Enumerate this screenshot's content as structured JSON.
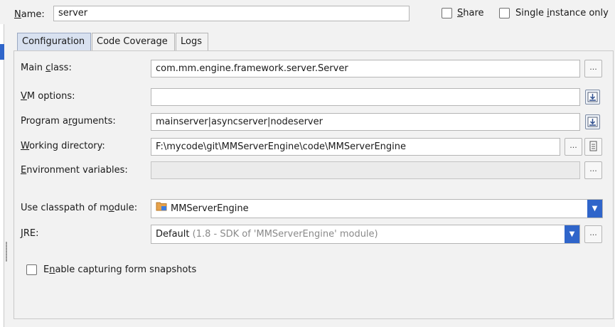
{
  "header": {
    "name_label": "Name:",
    "name_value": "server",
    "share_label": "Share",
    "share_checked": false,
    "single_instance_label": "Single instance only",
    "single_instance_checked": false
  },
  "tabs": [
    {
      "label": "Configuration",
      "active": true
    },
    {
      "label": "Code Coverage",
      "active": false
    },
    {
      "label": "Logs",
      "active": false
    }
  ],
  "form": {
    "main_class": {
      "label": "Main class:",
      "value": "com.mm.engine.framework.server.Server",
      "button": "..."
    },
    "vm_options": {
      "label": "VM options:",
      "value": ""
    },
    "program_arguments": {
      "label": "Program arguments:",
      "value": "mainserver|asyncserver|nodeserver"
    },
    "working_directory": {
      "label": "Working directory:",
      "value": "F:\\mycode\\git\\MMServerEngine\\code\\MMServerEngine",
      "button": "..."
    },
    "environment_variables": {
      "label": "Environment variables:",
      "value": "",
      "button": "..."
    },
    "module_classpath": {
      "label": "Use classpath of module:",
      "value": "MMServerEngine",
      "icon": "module-folder-icon"
    },
    "jre": {
      "label": "JRE:",
      "value": "Default",
      "detail": "(1.8 - SDK of 'MMServerEngine' module)",
      "button": "..."
    },
    "capture_snapshots": {
      "label": "Enable capturing form snapshots",
      "checked": false
    }
  },
  "colors": {
    "accent": "#2f65ca",
    "active_tab": "#d8e1f0",
    "background": "#f2f2f2"
  }
}
